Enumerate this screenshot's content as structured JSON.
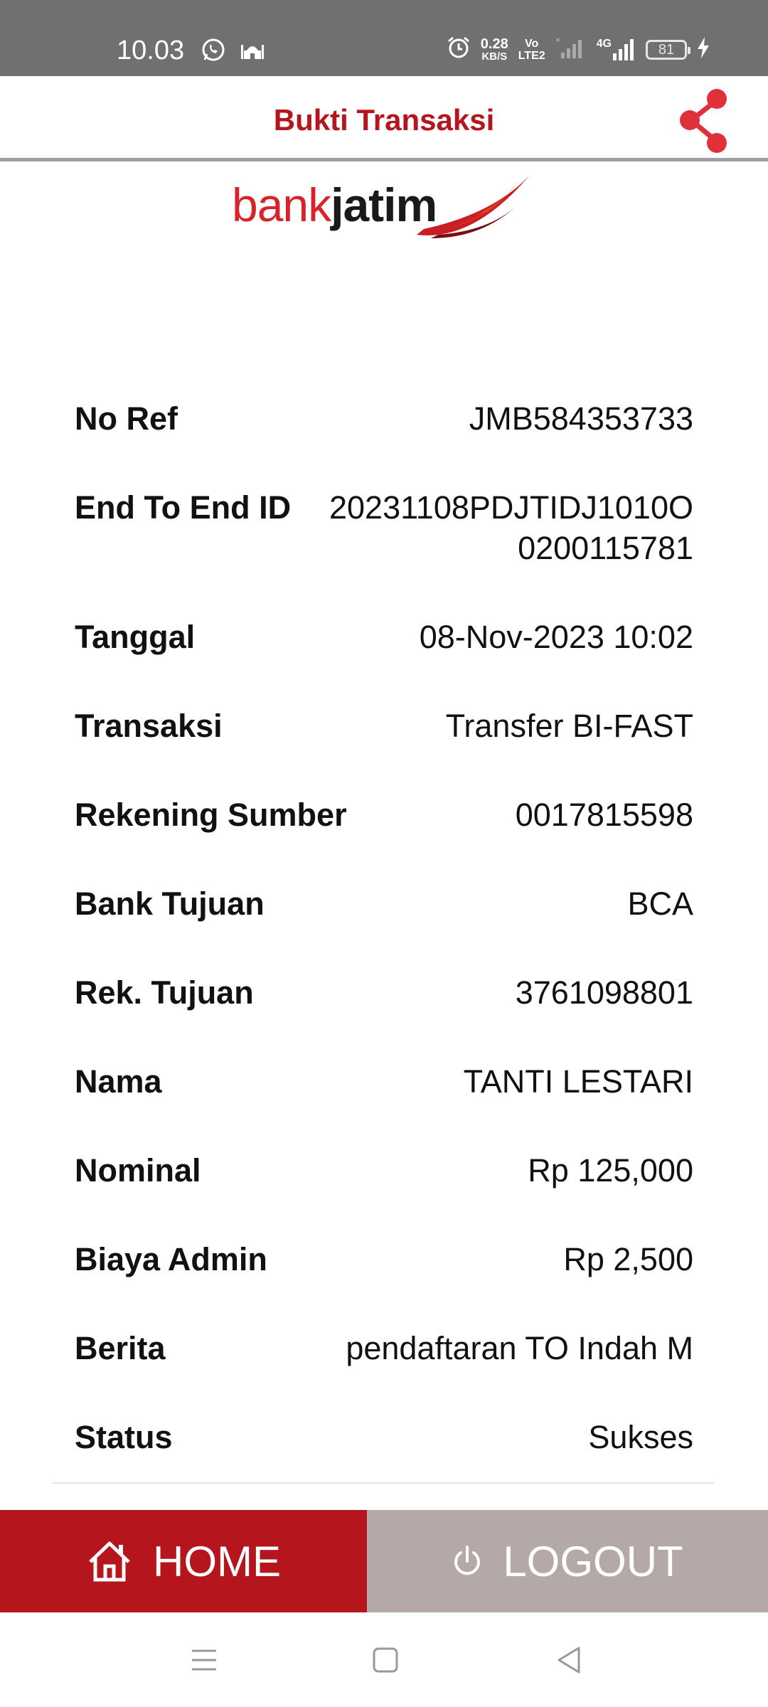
{
  "status_bar": {
    "time": "10.03",
    "net_speed_value": "0.28",
    "net_speed_unit": "KB/S",
    "volte_top": "Vo",
    "volte_bottom": "LTE2",
    "network_4g": "4G",
    "battery": "81",
    "icons": [
      "whatsapp-icon",
      "mosque-icon",
      "alarm-icon",
      "signal-icon",
      "charging-icon"
    ]
  },
  "header": {
    "title": "Bukti Transaksi",
    "share_icon": "share-icon",
    "accent_color": "#b5151d"
  },
  "logo": {
    "part1": "bank",
    "part2": "jatim"
  },
  "details": [
    {
      "label": "No Ref",
      "value": "JMB584353733"
    },
    {
      "label": "End To End ID",
      "value": "20231108PDJTIDJ1010O0200115781"
    },
    {
      "label": "Tanggal",
      "value": "08-Nov-2023 10:02"
    },
    {
      "label": "Transaksi",
      "value": "Transfer BI-FAST"
    },
    {
      "label": "Rekening Sumber",
      "value": "0017815598"
    },
    {
      "label": "Bank Tujuan",
      "value": "BCA"
    },
    {
      "label": "Rek. Tujuan",
      "value": "3761098801"
    },
    {
      "label": "Nama",
      "value": "TANTI LESTARI"
    },
    {
      "label": "Nominal",
      "value": "Rp 125,000"
    },
    {
      "label": "Biaya Admin",
      "value": "Rp 2,500"
    },
    {
      "label": "Berita",
      "value": "pendaftaran TO Indah M"
    },
    {
      "label": "Status",
      "value": "Sukses"
    }
  ],
  "buttons": {
    "home": {
      "label": "HOME",
      "icon": "home-icon",
      "color": "#b5151d"
    },
    "logout": {
      "label": "LOGOUT",
      "icon": "power-icon",
      "color": "#b5a8a8"
    }
  },
  "nav_bar": {
    "icons": [
      "menu-icon",
      "home-square-icon",
      "back-icon"
    ]
  }
}
